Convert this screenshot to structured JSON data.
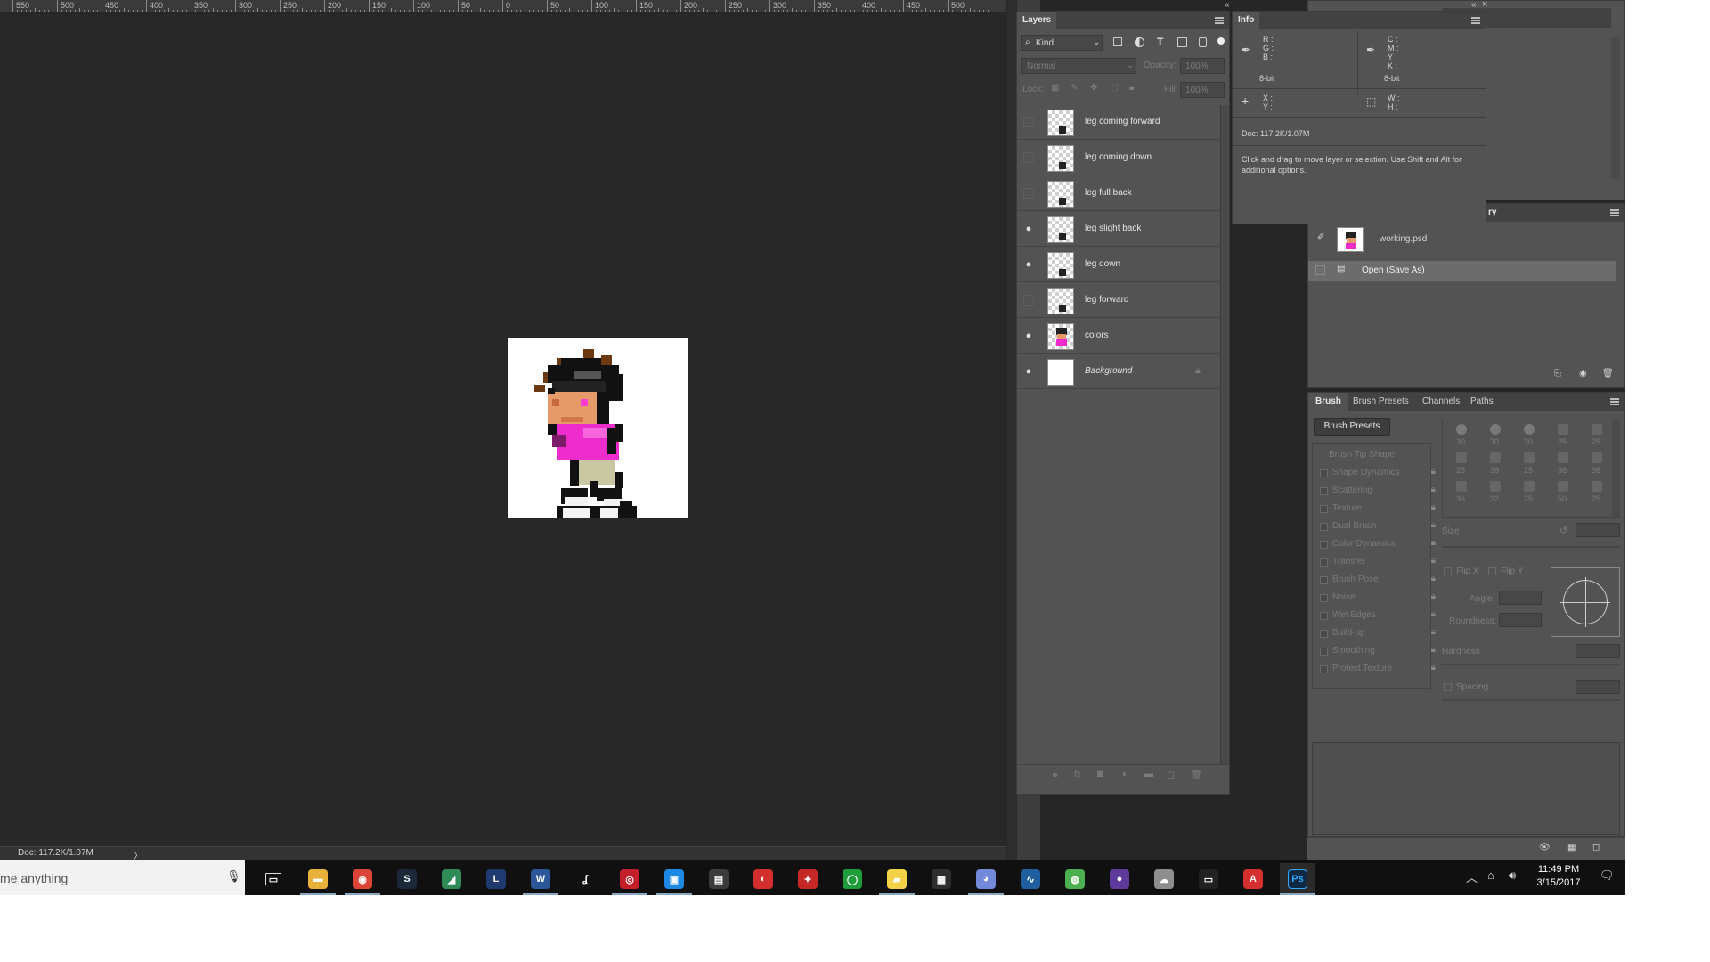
{
  "ruler": {
    "labels": [
      "550",
      "500",
      "450",
      "400",
      "350",
      "300",
      "250",
      "200",
      "150",
      "100",
      "50",
      "0",
      "50",
      "100",
      "150",
      "200",
      "250",
      "300",
      "350",
      "400",
      "450",
      "500"
    ]
  },
  "statusbar": {
    "doc_info": "Doc: 117.2K/1.07M",
    "arrow": "〉"
  },
  "layers_panel": {
    "tab": "Layers",
    "filter_kind": "Kind",
    "blend_mode": "Normal",
    "opacity_label": "Opacity:",
    "opacity_value": "100%",
    "lock_label": "Lock:",
    "fill_label": "Fill:",
    "fill_value": "100%",
    "layers": [
      {
        "name": "leg coming forward",
        "visible": false
      },
      {
        "name": "leg coming down",
        "visible": false
      },
      {
        "name": "leg full back",
        "visible": false
      },
      {
        "name": "leg slight back",
        "visible": true
      },
      {
        "name": "leg down",
        "visible": true
      },
      {
        "name": "leg forward",
        "visible": false
      },
      {
        "name": "colors",
        "visible": true
      },
      {
        "name": "Background",
        "visible": true,
        "locked": true
      }
    ],
    "eye_glyph": "●"
  },
  "info_panel": {
    "tab": "Info",
    "rgb_labels": [
      "R :",
      "G :",
      "B :"
    ],
    "cmyk_labels": [
      "C :",
      "M :",
      "Y :",
      "K :"
    ],
    "bit_left": "8-bit",
    "bit_right": "8-bit",
    "xy_labels": [
      "X :",
      "Y :"
    ],
    "wh_labels": [
      "W :",
      "H :"
    ],
    "doc_info": "Doc: 117.2K/1.07M",
    "hint": "Click and drag to move layer or selection.  Use Shift and Alt for additional options."
  },
  "history_panel": {
    "tab_partial": "ry",
    "items": [
      {
        "name": "working.psd"
      },
      {
        "name": "Open (Save As)"
      }
    ]
  },
  "brush_panel": {
    "tabs": [
      "Brush",
      "Brush Presets",
      "Channels",
      "Paths"
    ],
    "presets_button": "Brush Presets",
    "options": [
      "Brush Tip Shape",
      "Shape Dynamics",
      "Scattering",
      "Texture",
      "Dual Brush",
      "Color Dynamics",
      "Transfer",
      "Brush Pose",
      "Noise",
      "Wet Edges",
      "Build-up",
      "Smoothing",
      "Protect Texture"
    ],
    "tip_sizes": [
      "30",
      "30",
      "30",
      "25",
      "25",
      "25",
      "36",
      "25",
      "36",
      "36",
      "36",
      "32",
      "25",
      "50",
      "25"
    ],
    "size_label": "Size",
    "flip_x": "Flip X",
    "flip_y": "Flip Y",
    "angle_label": "Angle:",
    "roundness_label": "Roundness:",
    "hardness_label": "Hardness",
    "spacing_label": "Spacing"
  },
  "taskbar": {
    "search_text": "me anything",
    "apps": [
      {
        "name": "task-view",
        "glyph": "▭",
        "color": "#101010"
      },
      {
        "name": "file-explorer",
        "glyph": "▬",
        "color": "#e8b13a"
      },
      {
        "name": "chrome",
        "glyph": "◉",
        "color": "#db4437"
      },
      {
        "name": "steam",
        "glyph": "S",
        "color": "#1b2838"
      },
      {
        "name": "app-green",
        "glyph": "◢",
        "color": "#2e8b57"
      },
      {
        "name": "league",
        "glyph": "L",
        "color": "#1e3a6e"
      },
      {
        "name": "word",
        "glyph": "W",
        "color": "#2b579a"
      },
      {
        "name": "app-spiral",
        "glyph": "ʆ",
        "color": "#101010"
      },
      {
        "name": "app-red",
        "glyph": "◎",
        "color": "#c41e2a"
      },
      {
        "name": "app-blue",
        "glyph": "▣",
        "color": "#1e88e5"
      },
      {
        "name": "app-box",
        "glyph": "▤",
        "color": "#3b3b3b"
      },
      {
        "name": "opera",
        "glyph": "◐",
        "color": "#d22e2e"
      },
      {
        "name": "app-dragon",
        "glyph": "✦",
        "color": "#c62828"
      },
      {
        "name": "app-circle-green",
        "glyph": "◯",
        "color": "#1f9d3a"
      },
      {
        "name": "sticky-notes",
        "glyph": "▰",
        "color": "#f3d24a"
      },
      {
        "name": "calculator",
        "glyph": "▦",
        "color": "#2d2d2d"
      },
      {
        "name": "discord",
        "glyph": "◕",
        "color": "#7289da"
      },
      {
        "name": "app-wave",
        "glyph": "∿",
        "color": "#1f5fa0"
      },
      {
        "name": "app-globe",
        "glyph": "◍",
        "color": "#4caf50"
      },
      {
        "name": "app-purple",
        "glyph": "●",
        "color": "#5d3a9b"
      },
      {
        "name": "app-cloud",
        "glyph": "☁",
        "color": "#8e8e8e"
      },
      {
        "name": "terminal",
        "glyph": "▭",
        "color": "#222"
      },
      {
        "name": "acrobat",
        "glyph": "A",
        "color": "#d32f2f"
      },
      {
        "name": "photoshop",
        "glyph": "Ps",
        "color": "#0c2a45"
      }
    ],
    "time": "11:49 PM",
    "date": "3/15/2017"
  }
}
